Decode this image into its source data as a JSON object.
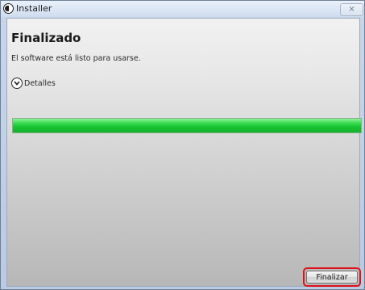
{
  "window": {
    "title": "Installer",
    "close_glyph": "⨯"
  },
  "page": {
    "heading": "Finalizado",
    "subtitle": "El software está listo para usarse."
  },
  "details": {
    "label": "Detalles",
    "icon": "chevron-down-circle"
  },
  "progress": {
    "value": 1.0
  },
  "footer": {
    "finish_label": "Finalizar"
  },
  "colors": {
    "progress_green": "#18c333",
    "highlight_red": "#e0101a"
  }
}
